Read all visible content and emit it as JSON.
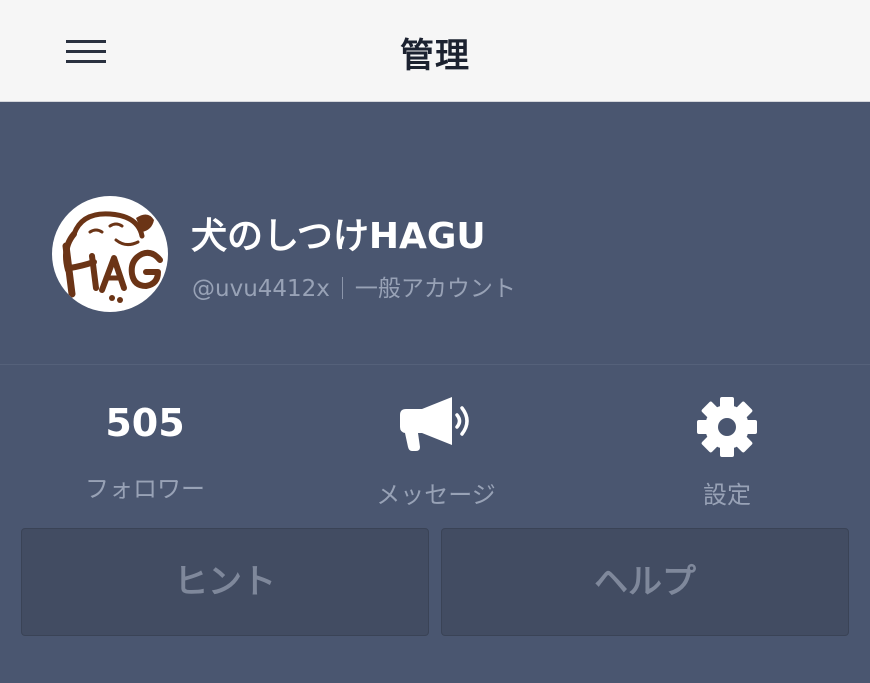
{
  "header": {
    "title": "管理"
  },
  "profile": {
    "name": "犬のしつけHAGU",
    "handle": "@uvu4412x",
    "account_type": "一般アカウント"
  },
  "stats": {
    "followers_count": "505",
    "followers_label": "フォロワー",
    "message_label": "メッセージ",
    "settings_label": "設定"
  },
  "buttons": {
    "hint_label": "ヒント",
    "help_label": "ヘルプ"
  },
  "colors": {
    "header_bg": "#f6f6f6",
    "main_bg": "#4a5670",
    "button_bg": "#424c62",
    "muted_text": "#98a2b6",
    "logo_brown": "#6b3416"
  },
  "icons": {
    "menu": "hamburger-icon",
    "message": "megaphone-icon",
    "settings": "gear-icon"
  }
}
